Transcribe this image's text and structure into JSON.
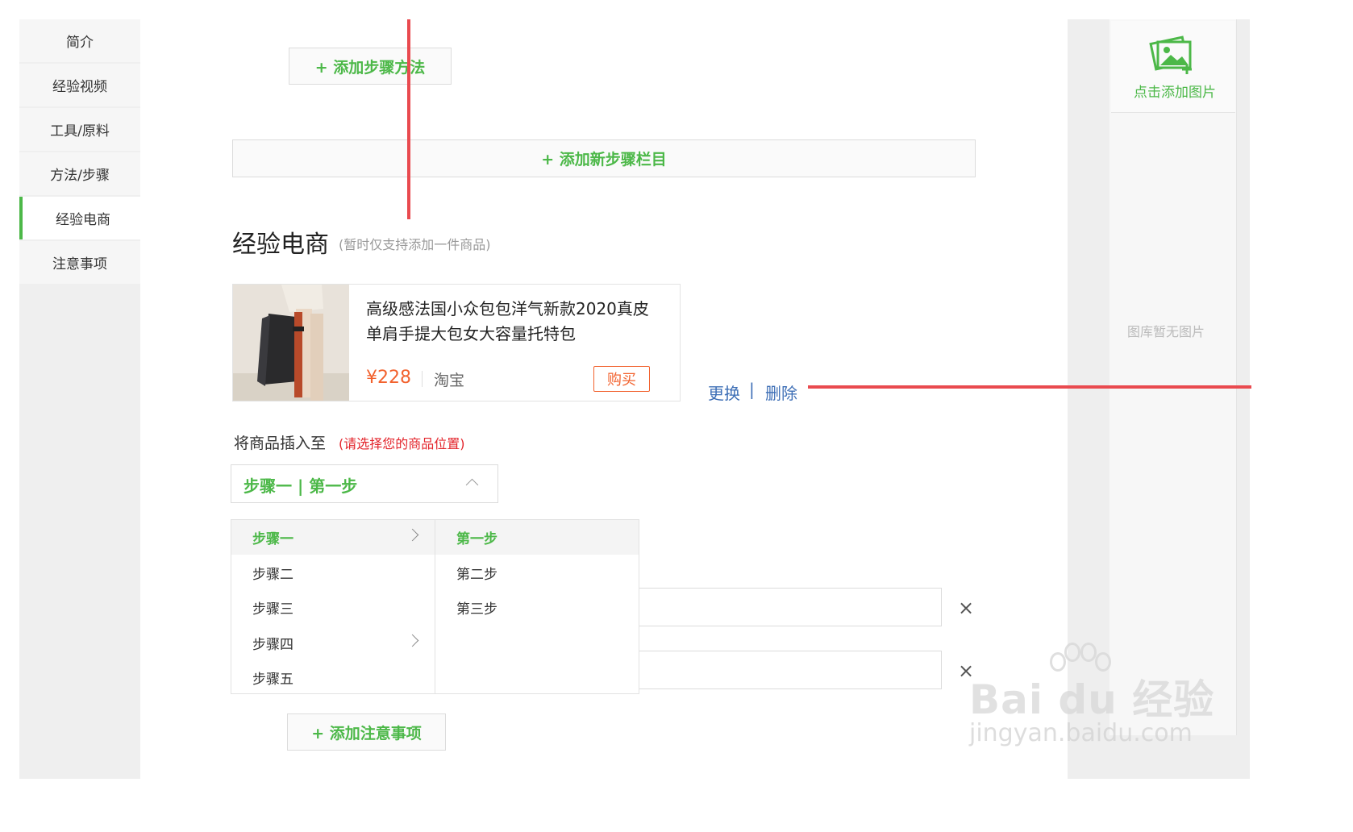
{
  "sidebar": {
    "items": [
      {
        "label": "简介"
      },
      {
        "label": "经验视频"
      },
      {
        "label": "工具/原料"
      },
      {
        "label": "方法/步骤"
      },
      {
        "label": "经验电商"
      },
      {
        "label": "注意事项"
      }
    ],
    "active_item": "经验电商"
  },
  "main": {
    "add_step_method": "+ 添加步骤方法",
    "add_new_step_section": "+ 添加新步骤栏目",
    "ecommerce": {
      "title": "经验电商",
      "subtitle": "(暂时仅支持添加一件商品)",
      "product": {
        "title": "高级感法国小众包包洋气新款2020真皮单肩手提大包女大容量托特包",
        "price": "¥228",
        "shop": "淘宝",
        "buy_label": "购买"
      },
      "replace_label": "更换",
      "separator": "|",
      "delete_label": "删除",
      "insert_label": "将商品插入至",
      "insert_hint": "(请选择您的商品位置)",
      "selected_position": "步骤一 | 第一步",
      "dropdown": {
        "steps": [
          {
            "label": "步骤一",
            "has_children": true
          },
          {
            "label": "步骤二",
            "has_children": false
          },
          {
            "label": "步骤三",
            "has_children": false
          },
          {
            "label": "步骤四",
            "has_children": true
          },
          {
            "label": "步骤五",
            "has_children": false
          }
        ],
        "substeps": [
          {
            "label": "第一步"
          },
          {
            "label": "第二步"
          },
          {
            "label": "第三步"
          }
        ],
        "active_step": "步骤一",
        "active_substep": "第一步"
      }
    },
    "close_symbol": "×",
    "add_notice": "+ 添加注意事项"
  },
  "gallery": {
    "add_label": "点击添加图片",
    "empty_label": "图库暂无图片"
  },
  "watermark": {
    "logo_text": "Bai du 经验",
    "url": "jingyan.baidu.com"
  },
  "colors": {
    "accent_green": "#4cb848",
    "price_orange": "#f2622e",
    "link_blue": "#3e6fb6",
    "hint_red": "#e3242b",
    "annotation_red": "#e94a4f"
  }
}
